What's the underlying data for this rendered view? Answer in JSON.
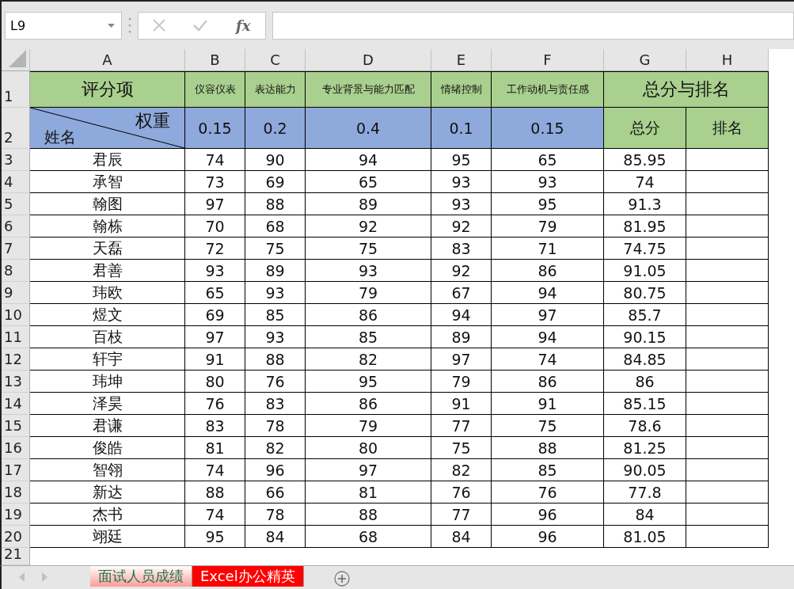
{
  "name_box": {
    "value": "L9"
  },
  "formula_bar": {
    "function_button": "fx"
  },
  "columns": [
    "A",
    "B",
    "C",
    "D",
    "E",
    "F",
    "G",
    "H"
  ],
  "header_row": {
    "number": "1",
    "title": "评分项",
    "items": [
      "仪容仪表",
      "表达能力",
      "专业背景与能力匹配",
      "情绪控制",
      "工作动机与责任感"
    ],
    "group": "总分与排名"
  },
  "weight_row": {
    "number": "2",
    "corner_top": "权重",
    "corner_bottom": "姓名",
    "weights": [
      "0.15",
      "0.2",
      "0.4",
      "0.1",
      "0.15"
    ],
    "total": "总分",
    "rank": "排名"
  },
  "rows": [
    {
      "number": "3",
      "name": "君辰",
      "scores": [
        "74",
        "90",
        "94",
        "95",
        "65"
      ],
      "total": "85.95"
    },
    {
      "number": "4",
      "name": "承智",
      "scores": [
        "73",
        "69",
        "65",
        "93",
        "93"
      ],
      "total": "74"
    },
    {
      "number": "5",
      "name": "翰图",
      "scores": [
        "97",
        "88",
        "89",
        "93",
        "95"
      ],
      "total": "91.3"
    },
    {
      "number": "6",
      "name": "翰栋",
      "scores": [
        "70",
        "68",
        "92",
        "92",
        "79"
      ],
      "total": "81.95"
    },
    {
      "number": "7",
      "name": "天磊",
      "scores": [
        "72",
        "75",
        "75",
        "83",
        "71"
      ],
      "total": "74.75"
    },
    {
      "number": "8",
      "name": "君善",
      "scores": [
        "93",
        "89",
        "93",
        "92",
        "86"
      ],
      "total": "91.05"
    },
    {
      "number": "9",
      "name": "玮欧",
      "scores": [
        "65",
        "93",
        "79",
        "67",
        "94"
      ],
      "total": "80.75"
    },
    {
      "number": "10",
      "name": "煜文",
      "scores": [
        "69",
        "85",
        "86",
        "94",
        "97"
      ],
      "total": "85.7"
    },
    {
      "number": "11",
      "name": "百枝",
      "scores": [
        "97",
        "93",
        "85",
        "89",
        "94"
      ],
      "total": "90.15"
    },
    {
      "number": "12",
      "name": "轩宇",
      "scores": [
        "91",
        "88",
        "82",
        "97",
        "74"
      ],
      "total": "84.85"
    },
    {
      "number": "13",
      "name": "玮坤",
      "scores": [
        "80",
        "76",
        "95",
        "79",
        "86"
      ],
      "total": "86"
    },
    {
      "number": "14",
      "name": "泽昊",
      "scores": [
        "76",
        "83",
        "86",
        "91",
        "91"
      ],
      "total": "85.15"
    },
    {
      "number": "15",
      "name": "君谦",
      "scores": [
        "83",
        "78",
        "79",
        "77",
        "75"
      ],
      "total": "78.6"
    },
    {
      "number": "16",
      "name": "俊皓",
      "scores": [
        "81",
        "82",
        "80",
        "75",
        "88"
      ],
      "total": "81.25"
    },
    {
      "number": "17",
      "name": "智翎",
      "scores": [
        "74",
        "96",
        "97",
        "82",
        "85"
      ],
      "total": "90.05"
    },
    {
      "number": "18",
      "name": "新达",
      "scores": [
        "88",
        "66",
        "81",
        "76",
        "76"
      ],
      "total": "77.8"
    },
    {
      "number": "19",
      "name": "杰书",
      "scores": [
        "74",
        "78",
        "88",
        "77",
        "96"
      ],
      "total": "84"
    },
    {
      "number": "20",
      "name": "翊廷",
      "scores": [
        "95",
        "84",
        "68",
        "84",
        "96"
      ],
      "total": "81.05"
    }
  ],
  "empty_row": {
    "number": "21"
  },
  "sheet_tabs": [
    {
      "label": "面试人员成绩",
      "selected": true,
      "color": "#ff9a9a"
    },
    {
      "label": "Excel办公精英",
      "selected": false,
      "color": "#ff0000"
    }
  ]
}
